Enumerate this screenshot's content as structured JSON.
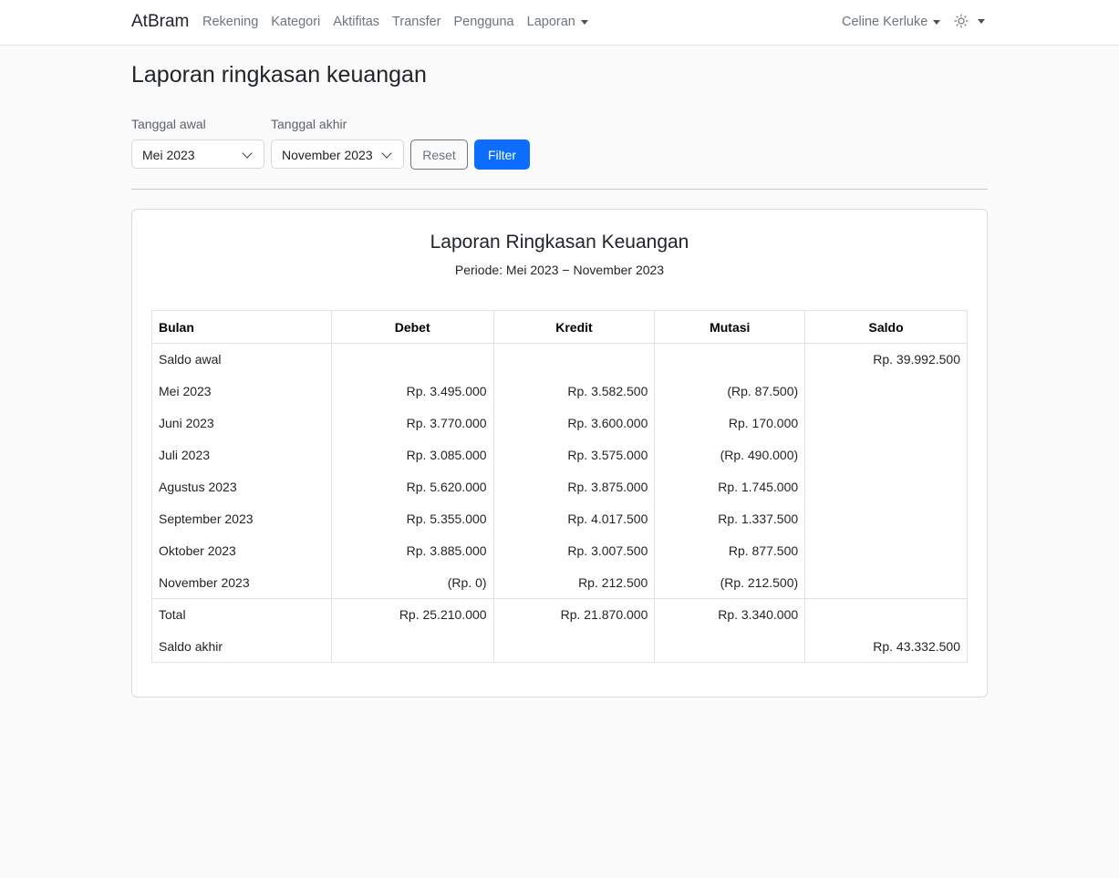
{
  "navbar": {
    "brand": "AtBram",
    "links": [
      "Rekening",
      "Kategori",
      "Aktifitas",
      "Transfer",
      "Pengguna"
    ],
    "report_menu": "Laporan",
    "user_name": "Celine Kerluke",
    "theme_icon": "sun-icon"
  },
  "page": {
    "title": "Laporan ringkasan keuangan"
  },
  "filter": {
    "start_label": "Tanggal awal",
    "start_value": "Mei 2023",
    "end_label": "Tanggal akhir",
    "end_value": "November 2023",
    "reset_label": "Reset",
    "filter_label": "Filter"
  },
  "report": {
    "title": "Laporan Ringkasan Keuangan",
    "period": "Periode: Mei 2023 − November 2023",
    "headers": [
      "Bulan",
      "Debet",
      "Kredit",
      "Mutasi",
      "Saldo"
    ],
    "opening": {
      "label": "Saldo awal",
      "saldo": "Rp. 39.992.500"
    },
    "months": [
      {
        "bulan": "Mei 2023",
        "debet": "Rp. 3.495.000",
        "kredit": "Rp. 3.582.500",
        "mutasi": "(Rp. 87.500)"
      },
      {
        "bulan": "Juni 2023",
        "debet": "Rp. 3.770.000",
        "kredit": "Rp. 3.600.000",
        "mutasi": "Rp. 170.000"
      },
      {
        "bulan": "Juli 2023",
        "debet": "Rp. 3.085.000",
        "kredit": "Rp. 3.575.000",
        "mutasi": "(Rp. 490.000)"
      },
      {
        "bulan": "Agustus 2023",
        "debet": "Rp. 5.620.000",
        "kredit": "Rp. 3.875.000",
        "mutasi": "Rp. 1.745.000"
      },
      {
        "bulan": "September 2023",
        "debet": "Rp. 5.355.000",
        "kredit": "Rp. 4.017.500",
        "mutasi": "Rp. 1.337.500"
      },
      {
        "bulan": "Oktober 2023",
        "debet": "Rp. 3.885.000",
        "kredit": "Rp. 3.007.500",
        "mutasi": "Rp. 877.500"
      },
      {
        "bulan": "November 2023",
        "debet": "(Rp. 0)",
        "kredit": "Rp. 212.500",
        "mutasi": "(Rp. 212.500)"
      }
    ],
    "total": {
      "label": "Total",
      "debet": "Rp. 25.210.000",
      "kredit": "Rp. 21.870.000",
      "mutasi": "Rp. 3.340.000"
    },
    "closing": {
      "label": "Saldo akhir",
      "saldo": "Rp. 43.332.500"
    }
  }
}
